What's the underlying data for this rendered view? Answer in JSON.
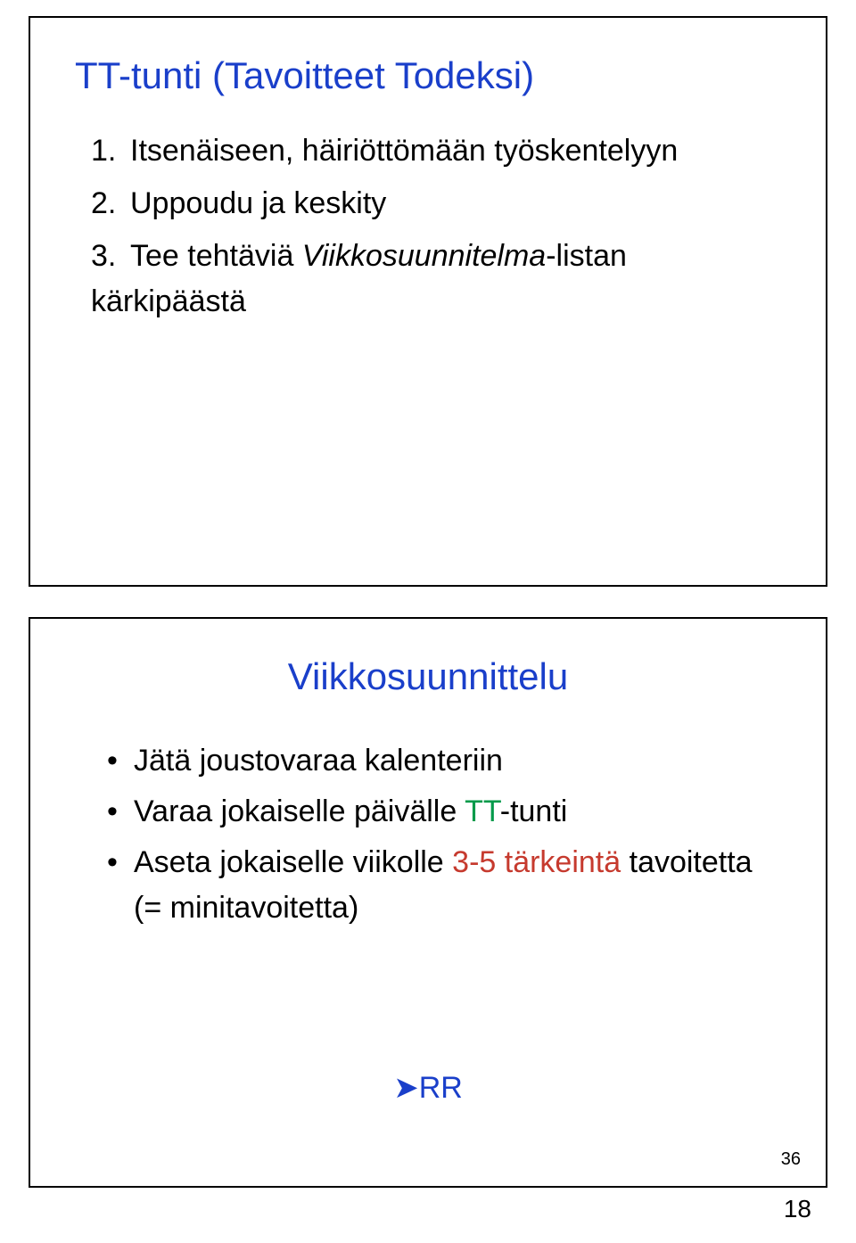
{
  "colors": {
    "blue": "#1a3fca",
    "green": "#009a4a",
    "red": "#c63a2e"
  },
  "slide1": {
    "title": "TT-tunti (Tavoitteet Todeksi)",
    "items": [
      {
        "marker": "1.",
        "text": "Itsenäiseen, häiriöttömään työskentelyyn"
      },
      {
        "marker": "2.",
        "text": "Uppoudu ja keskity"
      },
      {
        "marker": "3.",
        "pre": "Tee tehtäviä ",
        "em": "Viikkosuunnitelma",
        "post": "-listan kärkipäästä"
      }
    ]
  },
  "slide2": {
    "title": "Viikkosuunnittelu",
    "items": [
      {
        "text": "Jätä joustovaraa kalenteriin"
      },
      {
        "pre": "Varaa jokaiselle päivälle ",
        "hl": "TT",
        "post": "-tunti",
        "hlColor": "green"
      },
      {
        "pre": "Aseta jokaiselle viikolle ",
        "hl": "3-5 tärkeintä",
        "post": " tavoitetta (= minitavoitetta)",
        "hlColor": "red"
      }
    ],
    "rr_chev": "➔",
    "rr_text": "RR",
    "slide_number": "36"
  },
  "page_number": "18"
}
